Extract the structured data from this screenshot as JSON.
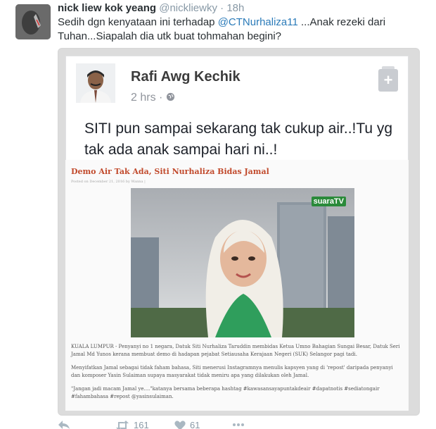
{
  "tweet": {
    "author_name": "nick liew kok yeang",
    "author_handle": "@nickliewky",
    "separator": "·",
    "time": "18h",
    "text_before": "Sedih dgn kenyataan ini terhadap ",
    "mention": "@CTNurhaliza11",
    "text_after": " ...Anak rezeki dari Tuhan...Siapalah dia utk buat tohmahan begini?"
  },
  "fb_post": {
    "author": "Rafi Awg Kechik",
    "time": "2 hrs",
    "separator": "·",
    "text": "SITI pun sampai sekarang tak cukup air..!Tu yg tak ada anak sampai hari ni..!"
  },
  "article": {
    "title": "Demo Air Tak Ada, Siti Nurhaliza Bidas Jamal",
    "date_line": "Posted on December 21, 2016 by Wanna |",
    "tv_logo": "suaraTV",
    "paragraphs": [
      "KUALA LUMPUR - Penyanyi no 1 negara, Datuk Siti Nurhaliza Taruddin membidas Ketua Umno Bahagian Sungai Besar, Datuk Seri Jamal Md Yunos kerana membuat demo di hadapan pejabat Setiausaha Kerajaan Negeri (SUK) Selangor pagi tadi.",
      "Menyifatkan Jamal sebagai tidak faham bahasa, Siti menerusi Instagramnya menulis kapsyen yang di 'repost' daripada penyanyi dan komposer Yasin Sulaiman supaya masyarakat tidak meniru apa yang dilakukan oleh Jamal.",
      "\"Jangan jadi macam Jamal ye....\"katanya bersama beberapa hashtag #kawasansayapuntakdeair #dapatnotis #sediatongair #fahambahasa #repost @yasinsulaiman."
    ]
  },
  "actions": {
    "reply_icon": "reply-icon",
    "retweet_icon": "retweet-icon",
    "retweet_count": "161",
    "like_icon": "heart-icon",
    "like_count": "61",
    "more_icon": "more-icon"
  },
  "colors": {
    "link": "#2b7bb9",
    "muted": "#8899a6",
    "article_title": "#c14a2c"
  }
}
